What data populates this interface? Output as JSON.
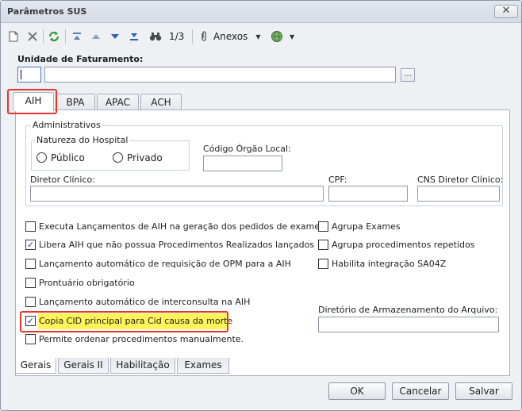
{
  "window": {
    "title": "Parâmetros SUS",
    "close_glyph": "✕"
  },
  "toolbar": {
    "new_icon": "new-document-icon",
    "delete_icon": "delete-icon",
    "refresh_icon": "refresh-icon",
    "first_icon": "first-record-icon",
    "prev_icon": "previous-record-icon",
    "next_icon": "next-record-icon",
    "last_icon": "last-record-icon",
    "search_icon": "binoculars-icon",
    "record_counter": "1/3",
    "attachments_label": "Anexos",
    "globe_icon": "globe-icon"
  },
  "billing_unit": {
    "label": "Unidade de Faturamento:",
    "code_value": "",
    "name_value": "",
    "browse_label": "..."
  },
  "top_tabs": [
    "AIH",
    "BPA",
    "APAC",
    "ACH"
  ],
  "admin": {
    "group_label": "Administrativos",
    "nature_label": "Natureza do Hospital",
    "public_label": "Público",
    "private_label": "Privado",
    "org_code_label": "Código Órgão Local:",
    "director_label": "Diretor Clínico:",
    "cpf_label": "CPF:",
    "cns_label": "CNS Diretor Clínico:"
  },
  "options_left": [
    {
      "label": "Executa Lançamentos de AIH na geração dos pedidos de exames?",
      "checked": false
    },
    {
      "label": "Libera AIH que não possua Procedimentos Realizados lançados",
      "checked": true
    },
    {
      "label": "Lançamento automático de requisição de OPM para a AIH",
      "checked": false
    },
    {
      "label": "Prontuário obrigatório",
      "checked": false
    },
    {
      "label": "Lançamento automático de interconsulta na AIH",
      "checked": false
    },
    {
      "label": "Copia CID principal para Cid causa da morte",
      "checked": true
    },
    {
      "label": "Permite ordenar procedimentos manualmente.",
      "checked": false
    }
  ],
  "options_right": [
    {
      "label": "Agrupa Exames",
      "checked": false
    },
    {
      "label": "Agrupa procedimentos repetidos",
      "checked": false
    },
    {
      "label": "Habilita integração SA04Z",
      "checked": false
    }
  ],
  "archive_dir_label": "Diretório de Armazenamento do Arquivo:",
  "bottom_tabs": [
    "Gerais",
    "Gerais II",
    "Habilitação",
    "Exames"
  ],
  "buttons": {
    "ok": "OK",
    "cancel": "Cancelar",
    "save": "Salvar"
  },
  "check_glyph": "✓",
  "colors": {
    "highlight_red": "#e4352e",
    "highlight_yellow": "#fff35a"
  }
}
